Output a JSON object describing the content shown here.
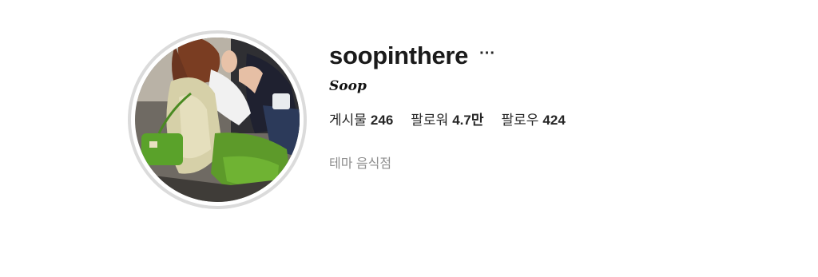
{
  "profile": {
    "username": "soopinthere",
    "more_icon": "more-horizontal-icon",
    "more_label": "···",
    "display_name": "Soop",
    "stats": [
      {
        "label": "게시물",
        "value": "246"
      },
      {
        "label": "팔로워",
        "value": "4.7만"
      },
      {
        "label": "팔로우",
        "value": "424"
      }
    ],
    "category": "테마 음식점"
  },
  "colors": {
    "ring": "#dbdbdb",
    "text_primary": "#262626",
    "text_secondary": "#8e8e8e"
  }
}
